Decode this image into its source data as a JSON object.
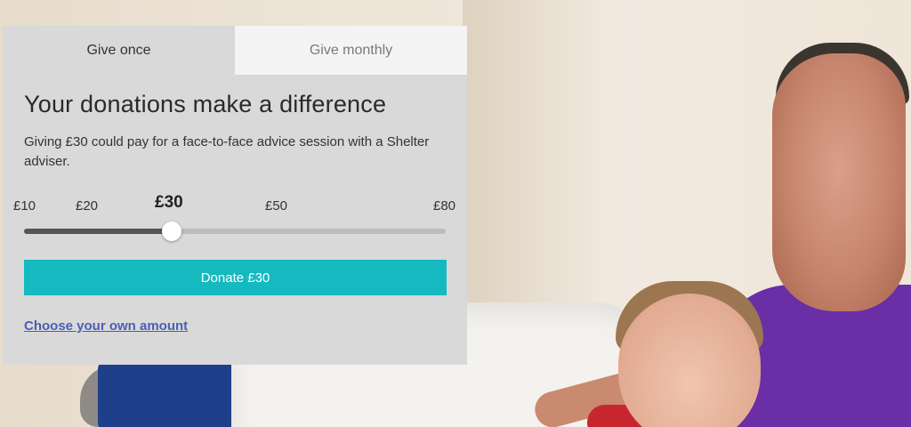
{
  "tabs": [
    {
      "label": "Give once",
      "active": true
    },
    {
      "label": "Give monthly",
      "active": false
    }
  ],
  "heading": "Your donations make a difference",
  "description": "Giving £30 could pay for a face-to-face advice session with a Shelter adviser.",
  "slider": {
    "labels": [
      "£10",
      "£20",
      "£30",
      "£50",
      "£80"
    ],
    "selected_label": "£30",
    "selected_fraction": 0.35
  },
  "donate_button": "Donate £30",
  "own_amount_link": "Choose your own amount",
  "colors": {
    "button": "#14bac0",
    "link": "#4a5fb5",
    "panel": "#d9d9d9"
  }
}
